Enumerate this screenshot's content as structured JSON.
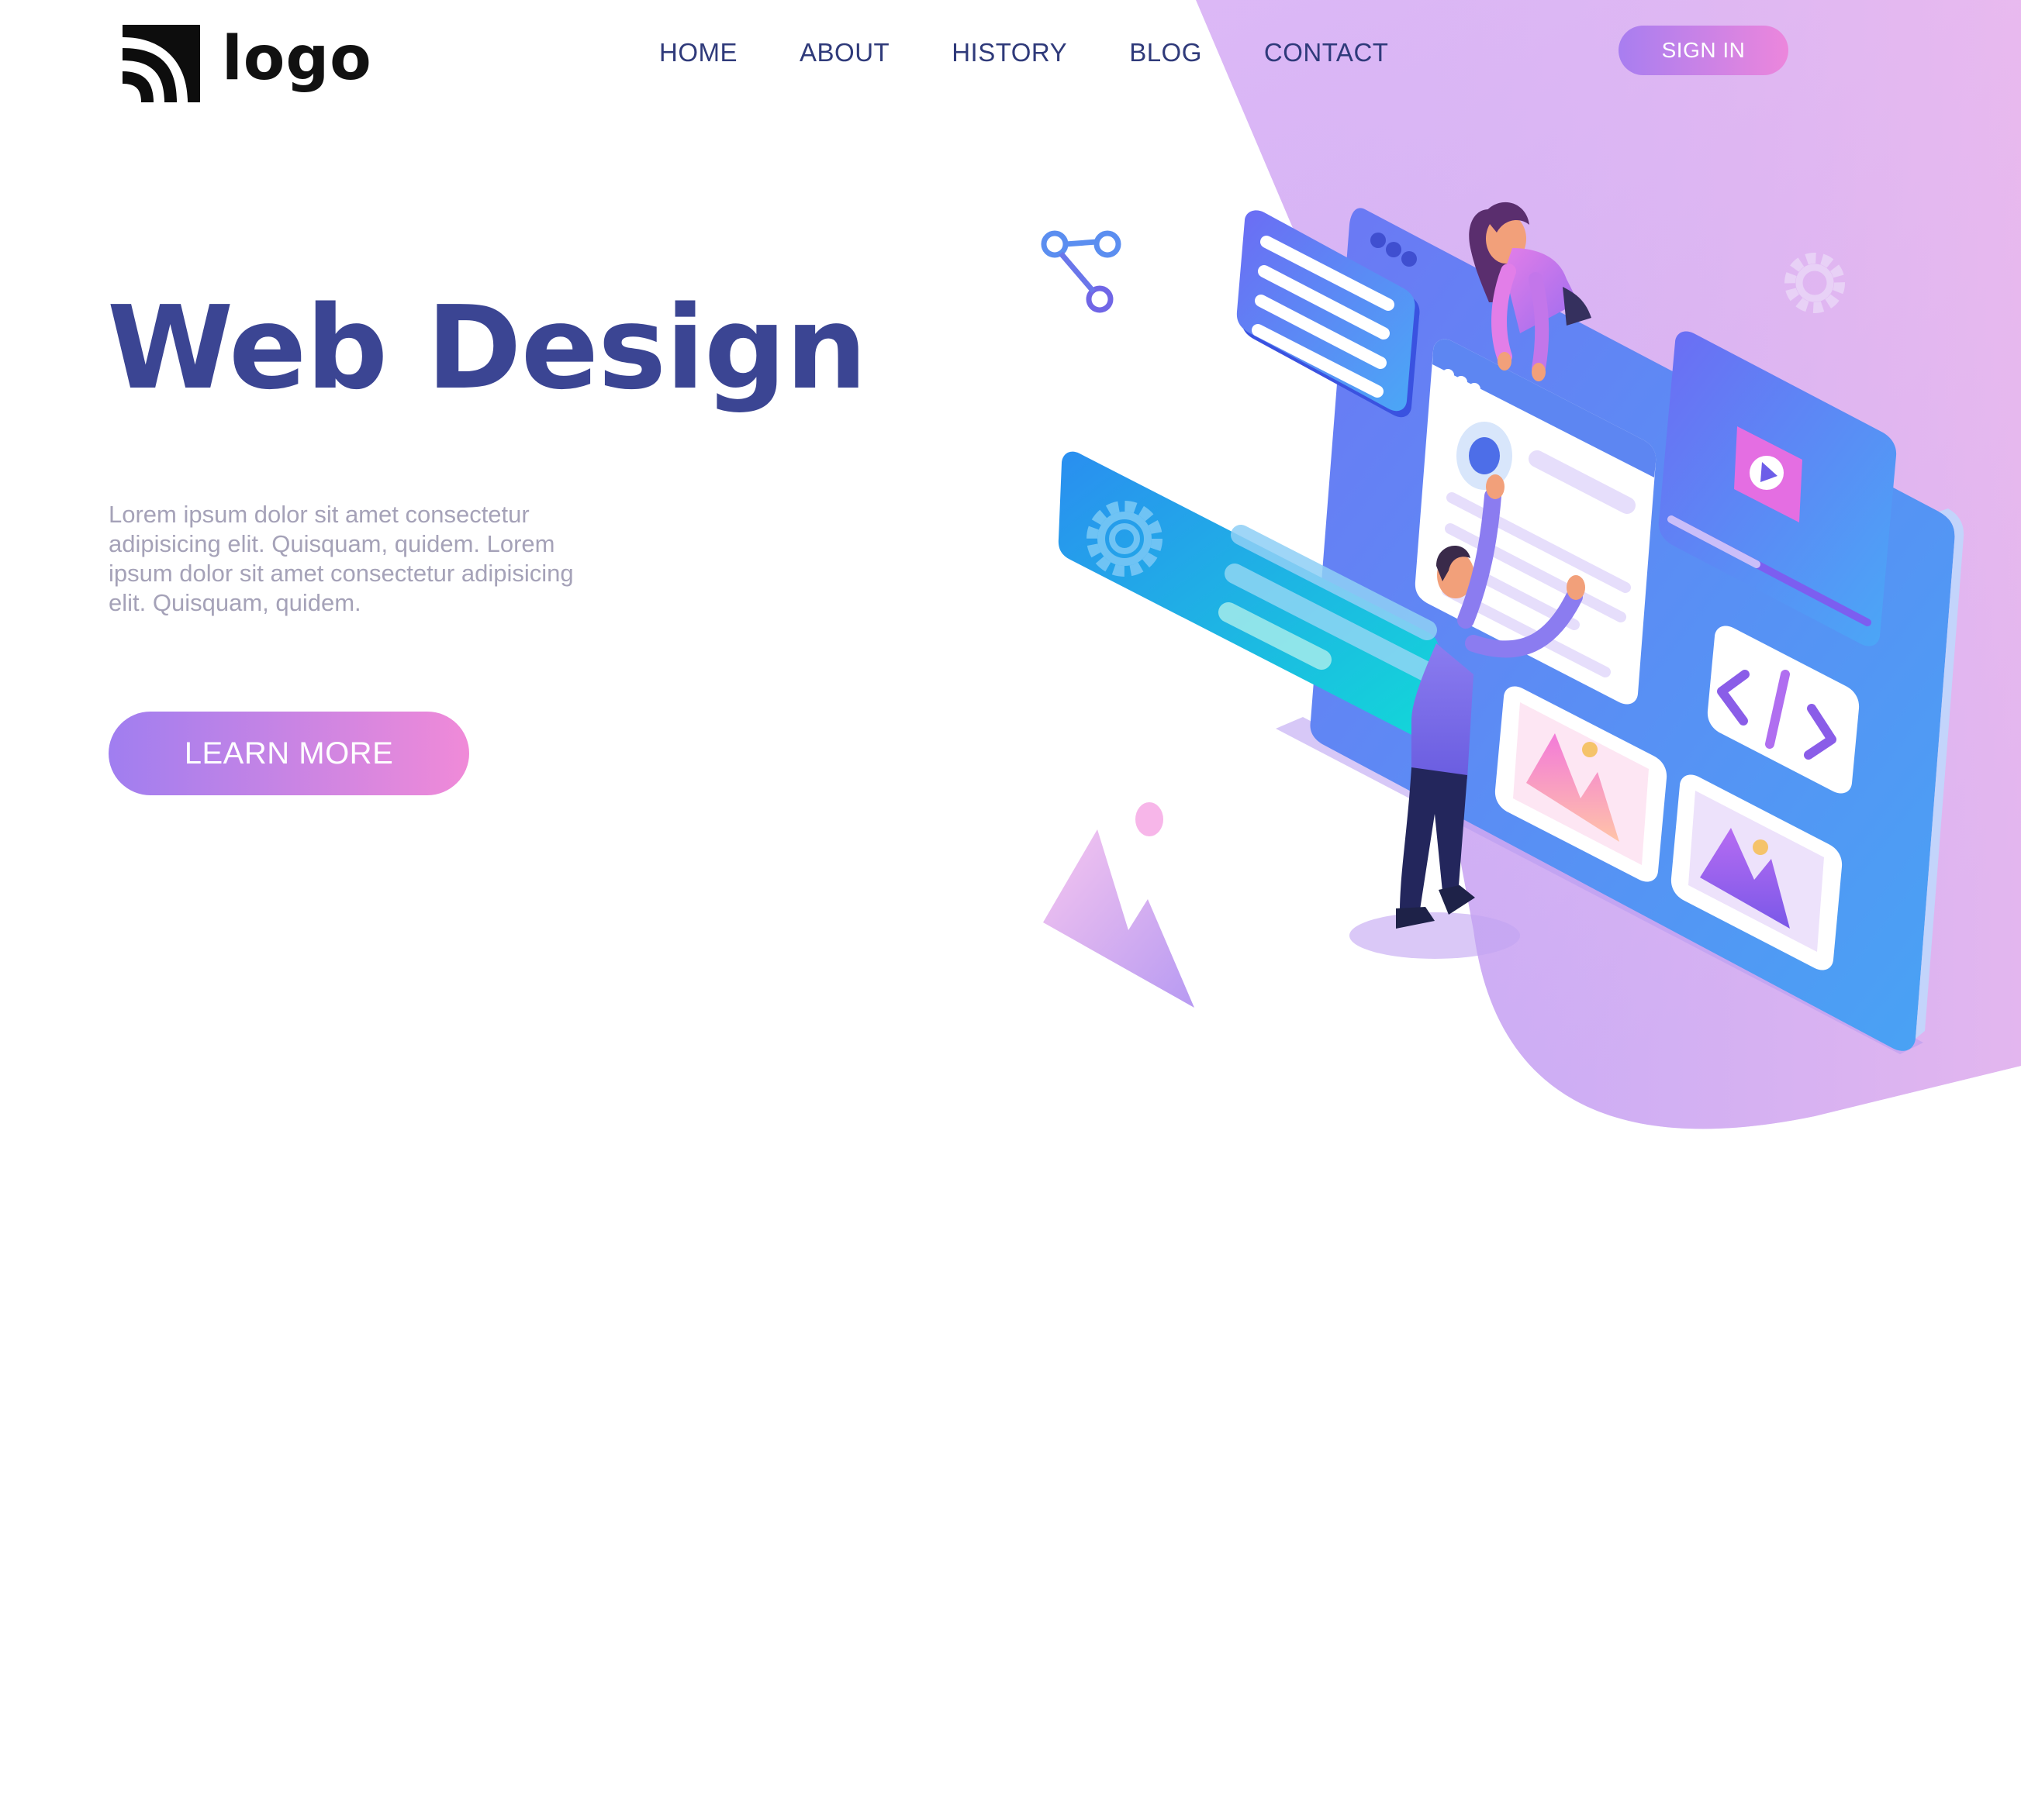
{
  "header": {
    "logo_text": "logo",
    "nav": [
      {
        "label": "HOME"
      },
      {
        "label": "ABOUT"
      },
      {
        "label": "HISTORY"
      },
      {
        "label": "BLOG"
      },
      {
        "label": "CONTACT"
      }
    ],
    "sign_in_label": "SIGN IN"
  },
  "hero": {
    "title": "Web Design",
    "description": "Lorem ipsum dolor sit amet consectetur adipisicing elit. Quisquam, quidem. Lorem ipsum dolor sit amet consectetur adipisicing elit. Quisquam, quidem.",
    "cta_label": "LEARN MORE"
  },
  "icons": {
    "logo": "rss-arcs-logo-icon",
    "share": "share-icon",
    "gear": "gear-icon",
    "code": "code-icon",
    "image": "image-icon",
    "play": "play-icon"
  },
  "colors": {
    "primary_text": "#3b4593",
    "nav_text": "#2f3a7a",
    "body_text": "#a5a2b8",
    "gradient_start": "#a07ef0",
    "gradient_end": "#f08ad8",
    "hero_background_top": "#d8b4f4",
    "hero_background_bottom": "#c6a8f4",
    "screen_blue": "#4f8ff2"
  }
}
